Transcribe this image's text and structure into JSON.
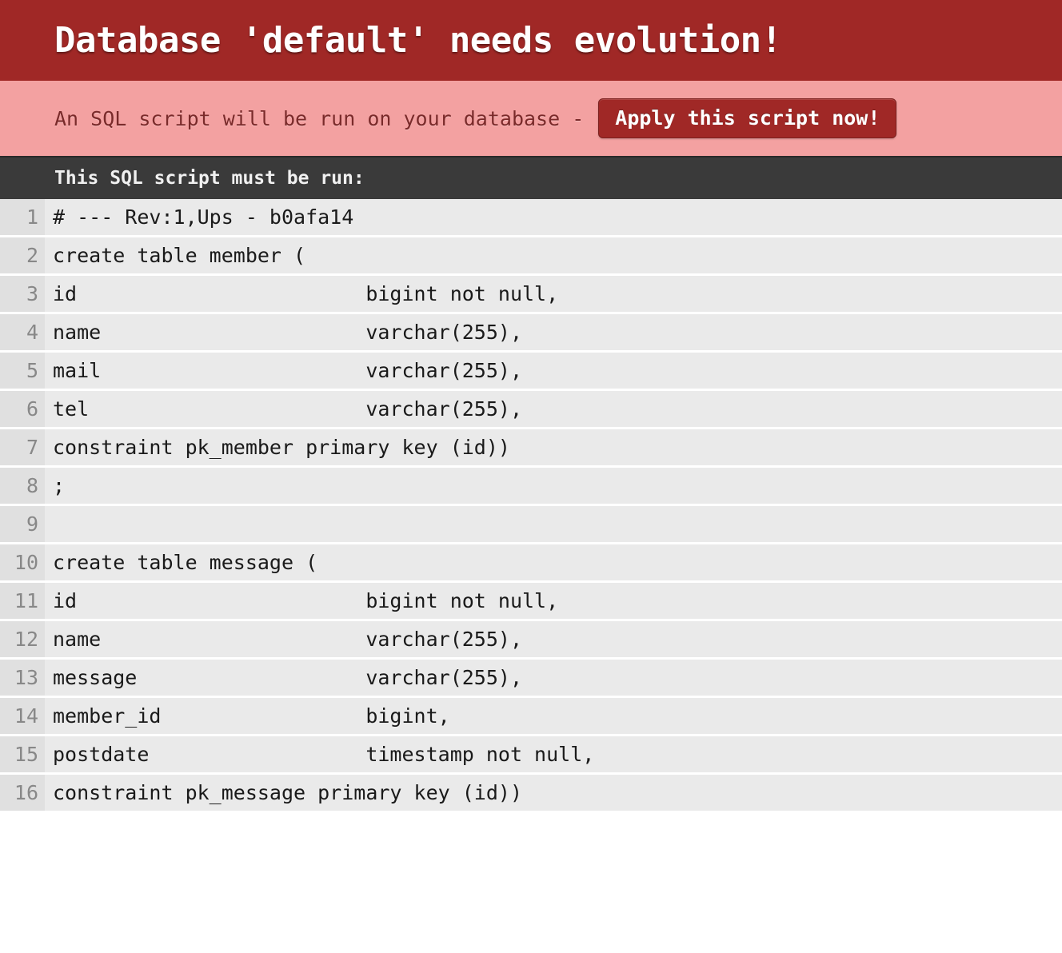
{
  "header": {
    "title": "Database 'default' needs evolution!"
  },
  "action": {
    "prompt": "An SQL script will be run on your database -",
    "button_label": "Apply this script now!"
  },
  "script_section": {
    "heading": "This SQL script must be run:"
  },
  "code": {
    "lines": [
      "# --- Rev:1,Ups - b0afa14",
      "create table member (",
      "id                        bigint not null,",
      "name                      varchar(255),",
      "mail                      varchar(255),",
      "tel                       varchar(255),",
      "constraint pk_member primary key (id))",
      ";",
      "",
      "create table message (",
      "id                        bigint not null,",
      "name                      varchar(255),",
      "message                   varchar(255),",
      "member_id                 bigint,",
      "postdate                  timestamp not null,",
      "constraint pk_message primary key (id))"
    ]
  }
}
